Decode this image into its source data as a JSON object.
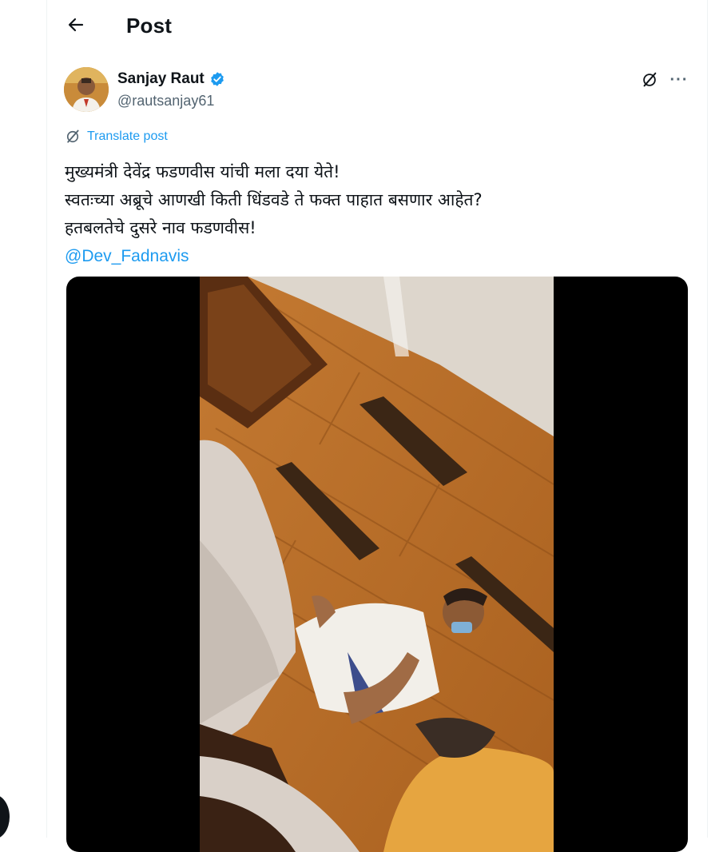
{
  "header": {
    "back_icon": "arrow-left-icon",
    "title": "Post"
  },
  "post": {
    "author": {
      "name": "Sanjay Raut",
      "handle": "@rautsanjay61",
      "verified_icon": "verified-badge-icon"
    },
    "grok_icon": "grok-icon",
    "more_icon": "more-horizontal-icon",
    "more_label": "···",
    "translate_label": "Translate post",
    "text_lines": [
      "मुख्यमंत्री देवेंद्र फडणवीस यांची मला दया येते!",
      "स्वतःच्या अब्रूचे आणखी किती धिंडवडे ते फक्त पाहात बसणार आहेत?",
      "हतबलतेचे दुसरे नाव फडणवीस!"
    ],
    "mention": "@Dev_Fadnavis",
    "media_type": "video"
  },
  "colors": {
    "accent": "#1d9bf0",
    "text": "#0f1419",
    "secondary": "#536471"
  }
}
